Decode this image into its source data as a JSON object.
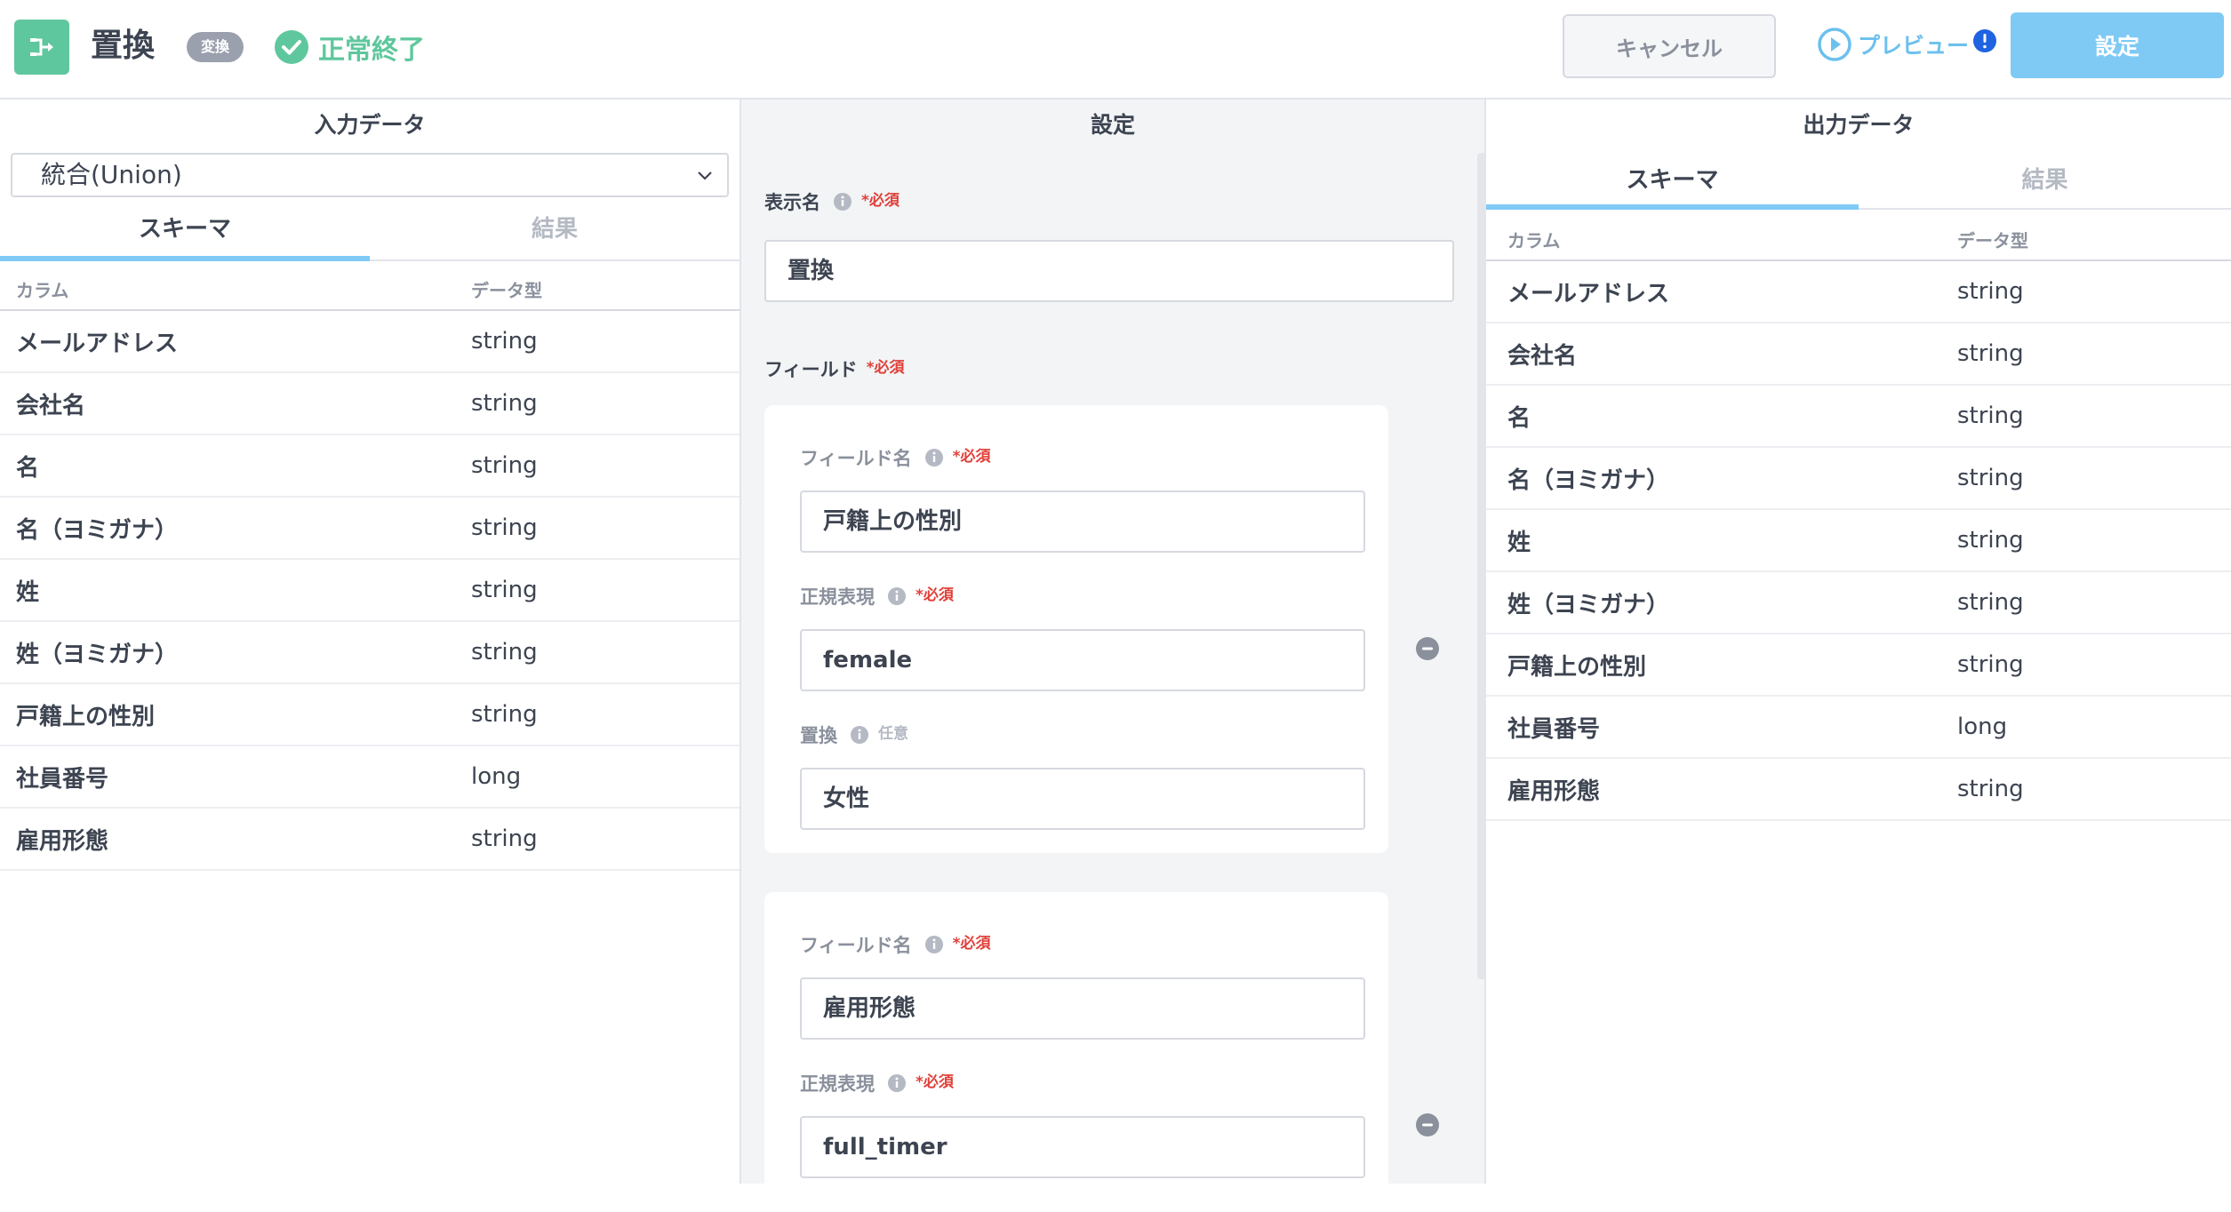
{
  "header": {
    "title": "置換",
    "badge": "変換",
    "status": "正常終了",
    "cancel_label": "キャンセル",
    "preview_label": "プレビュー",
    "setting_label": "設定",
    "colors": {
      "accent": "#7fcaf5",
      "success": "#5fc79d",
      "alert": "#1f63e0"
    }
  },
  "input_panel": {
    "title": "入力データ",
    "source_select": "統合(Union)",
    "tabs": [
      "スキーマ",
      "結果"
    ],
    "headers": [
      "カラム",
      "データ型"
    ],
    "rows": [
      [
        "メールアドレス",
        "string"
      ],
      [
        "会社名",
        "string"
      ],
      [
        "名",
        "string"
      ],
      [
        "名（ヨミガナ）",
        "string"
      ],
      [
        "姓",
        "string"
      ],
      [
        "姓（ヨミガナ）",
        "string"
      ],
      [
        "戸籍上の性別",
        "string"
      ],
      [
        "社員番号",
        "long"
      ],
      [
        "雇用形態",
        "string"
      ]
    ]
  },
  "settings_panel": {
    "title": "設定",
    "display_name_label": "表示名",
    "required": "*必須",
    "optional": "任意",
    "display_name_value": "置換",
    "fields_label": "フィールド",
    "field_name_label": "フィールド名",
    "regex_label": "正規表現",
    "replace_label": "置換",
    "fields": [
      {
        "field_name": "戸籍上の性別",
        "regex": "female",
        "replace": "女性"
      },
      {
        "field_name": "雇用形態",
        "regex": "full_timer",
        "replace": ""
      }
    ]
  },
  "output_panel": {
    "title": "出力データ",
    "tabs": [
      "スキーマ",
      "結果"
    ],
    "headers": [
      "カラム",
      "データ型"
    ],
    "rows": [
      [
        "メールアドレス",
        "string"
      ],
      [
        "会社名",
        "string"
      ],
      [
        "名",
        "string"
      ],
      [
        "名（ヨミガナ）",
        "string"
      ],
      [
        "姓",
        "string"
      ],
      [
        "姓（ヨミガナ）",
        "string"
      ],
      [
        "戸籍上の性別",
        "string"
      ],
      [
        "社員番号",
        "long"
      ],
      [
        "雇用形態",
        "string"
      ]
    ]
  }
}
